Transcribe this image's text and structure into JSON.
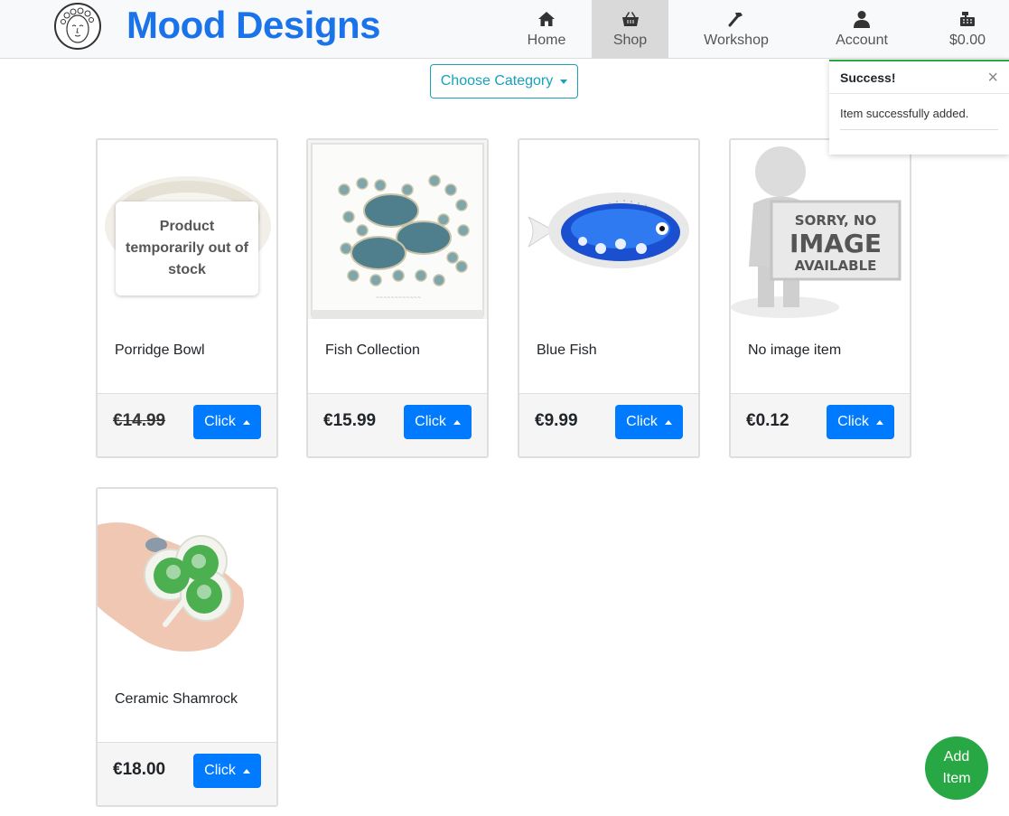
{
  "brand": {
    "title_part1": "Mood",
    "title_part2": "Designs",
    "color": "#1a73e8"
  },
  "nav": {
    "items": [
      {
        "label": "Home",
        "icon": "home-icon"
      },
      {
        "label": "Shop",
        "icon": "basket-icon",
        "active": true
      },
      {
        "label": "Workshop",
        "icon": "hammer-icon"
      },
      {
        "label": "Account",
        "icon": "user-icon"
      },
      {
        "label": "$0.00",
        "icon": "cash-register-icon"
      }
    ]
  },
  "category": {
    "label": "Choose Category"
  },
  "toast": {
    "title": "Success!",
    "message": "Item successfully added.",
    "close": "×",
    "accent": "#28a745"
  },
  "products": [
    {
      "title": "Porridge Bowl",
      "price": "€14.99",
      "struck": true,
      "overlay": "Product temporarily out of stock",
      "button": "Click",
      "image": "porridge-bowl-image"
    },
    {
      "title": "Fish Collection",
      "price": "€15.99",
      "button": "Click",
      "image": "fish-collection-image"
    },
    {
      "title": "Blue Fish",
      "price": "€9.99",
      "button": "Click",
      "image": "blue-fish-image"
    },
    {
      "title": "No image item",
      "price": "€0.12",
      "button": "Click",
      "image": "no-image-placeholder",
      "placeholder_text": [
        "SORRY, NO",
        "IMAGE",
        "AVAILABLE"
      ]
    },
    {
      "title": "Ceramic Shamrock",
      "price": "€18.00",
      "button": "Click",
      "image": "ceramic-shamrock-image"
    }
  ],
  "fab": {
    "line1": "Add",
    "line2": "Item",
    "color": "#28a745"
  },
  "colors": {
    "primary": "#007bff",
    "info": "#17a2b8",
    "success": "#28a745"
  }
}
